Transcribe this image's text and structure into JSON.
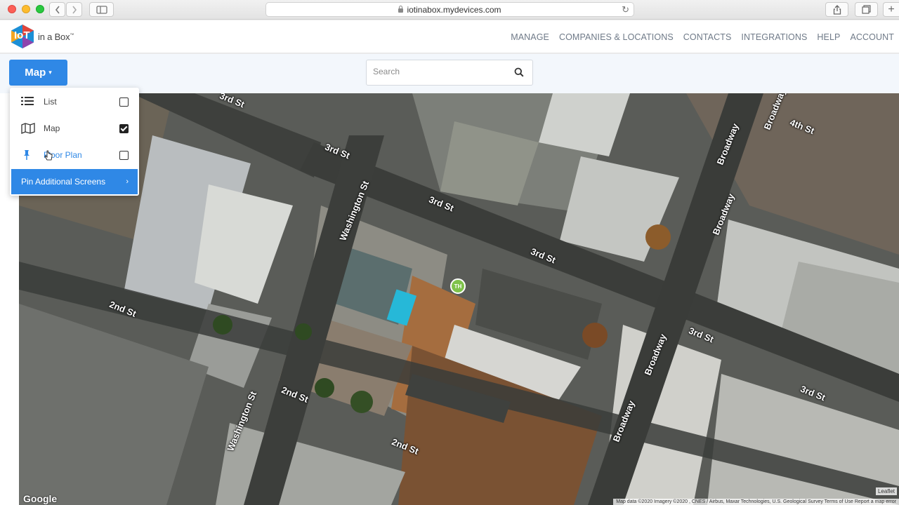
{
  "browser": {
    "url": "iotinabox.mydevices.com"
  },
  "app": {
    "logo_text": "in a Box",
    "logo_mark": "IoT",
    "logo_tm": "™",
    "nav": [
      "MANAGE",
      "COMPANIES & LOCATIONS",
      "CONTACTS",
      "INTEGRATIONS",
      "HELP",
      "ACCOUNT"
    ]
  },
  "toolbar": {
    "view_button": "Map",
    "search_placeholder": "Search"
  },
  "dropdown": {
    "items": [
      {
        "label": "List",
        "icon": "list-icon",
        "checked": false
      },
      {
        "label": "Map",
        "icon": "map-icon",
        "checked": true
      },
      {
        "label": "Floor Plan",
        "icon": "pin-icon",
        "checked": false
      }
    ],
    "pin_additional": "Pin Additional Screens"
  },
  "map": {
    "streets": [
      "3rd St",
      "3rd St",
      "3rd St",
      "3rd St",
      "3rd St",
      "3rd St",
      "Washington St",
      "Washington St",
      "2nd St",
      "2nd St",
      "2nd St",
      "Broadway",
      "Broadway",
      "Broadway",
      "Broadway",
      "Broadway",
      "4th St"
    ],
    "marker": "TH",
    "google": "Google",
    "leaflet": "Leaflet",
    "attribution": "Map data ©2020 Imagery ©2020 , CNES / Airbus, Maxar Technologies, U.S. Geological Survey   Terms of Use   Report a map error"
  },
  "colors": {
    "accent": "#2f88e6",
    "marker": "#7ec24a"
  }
}
